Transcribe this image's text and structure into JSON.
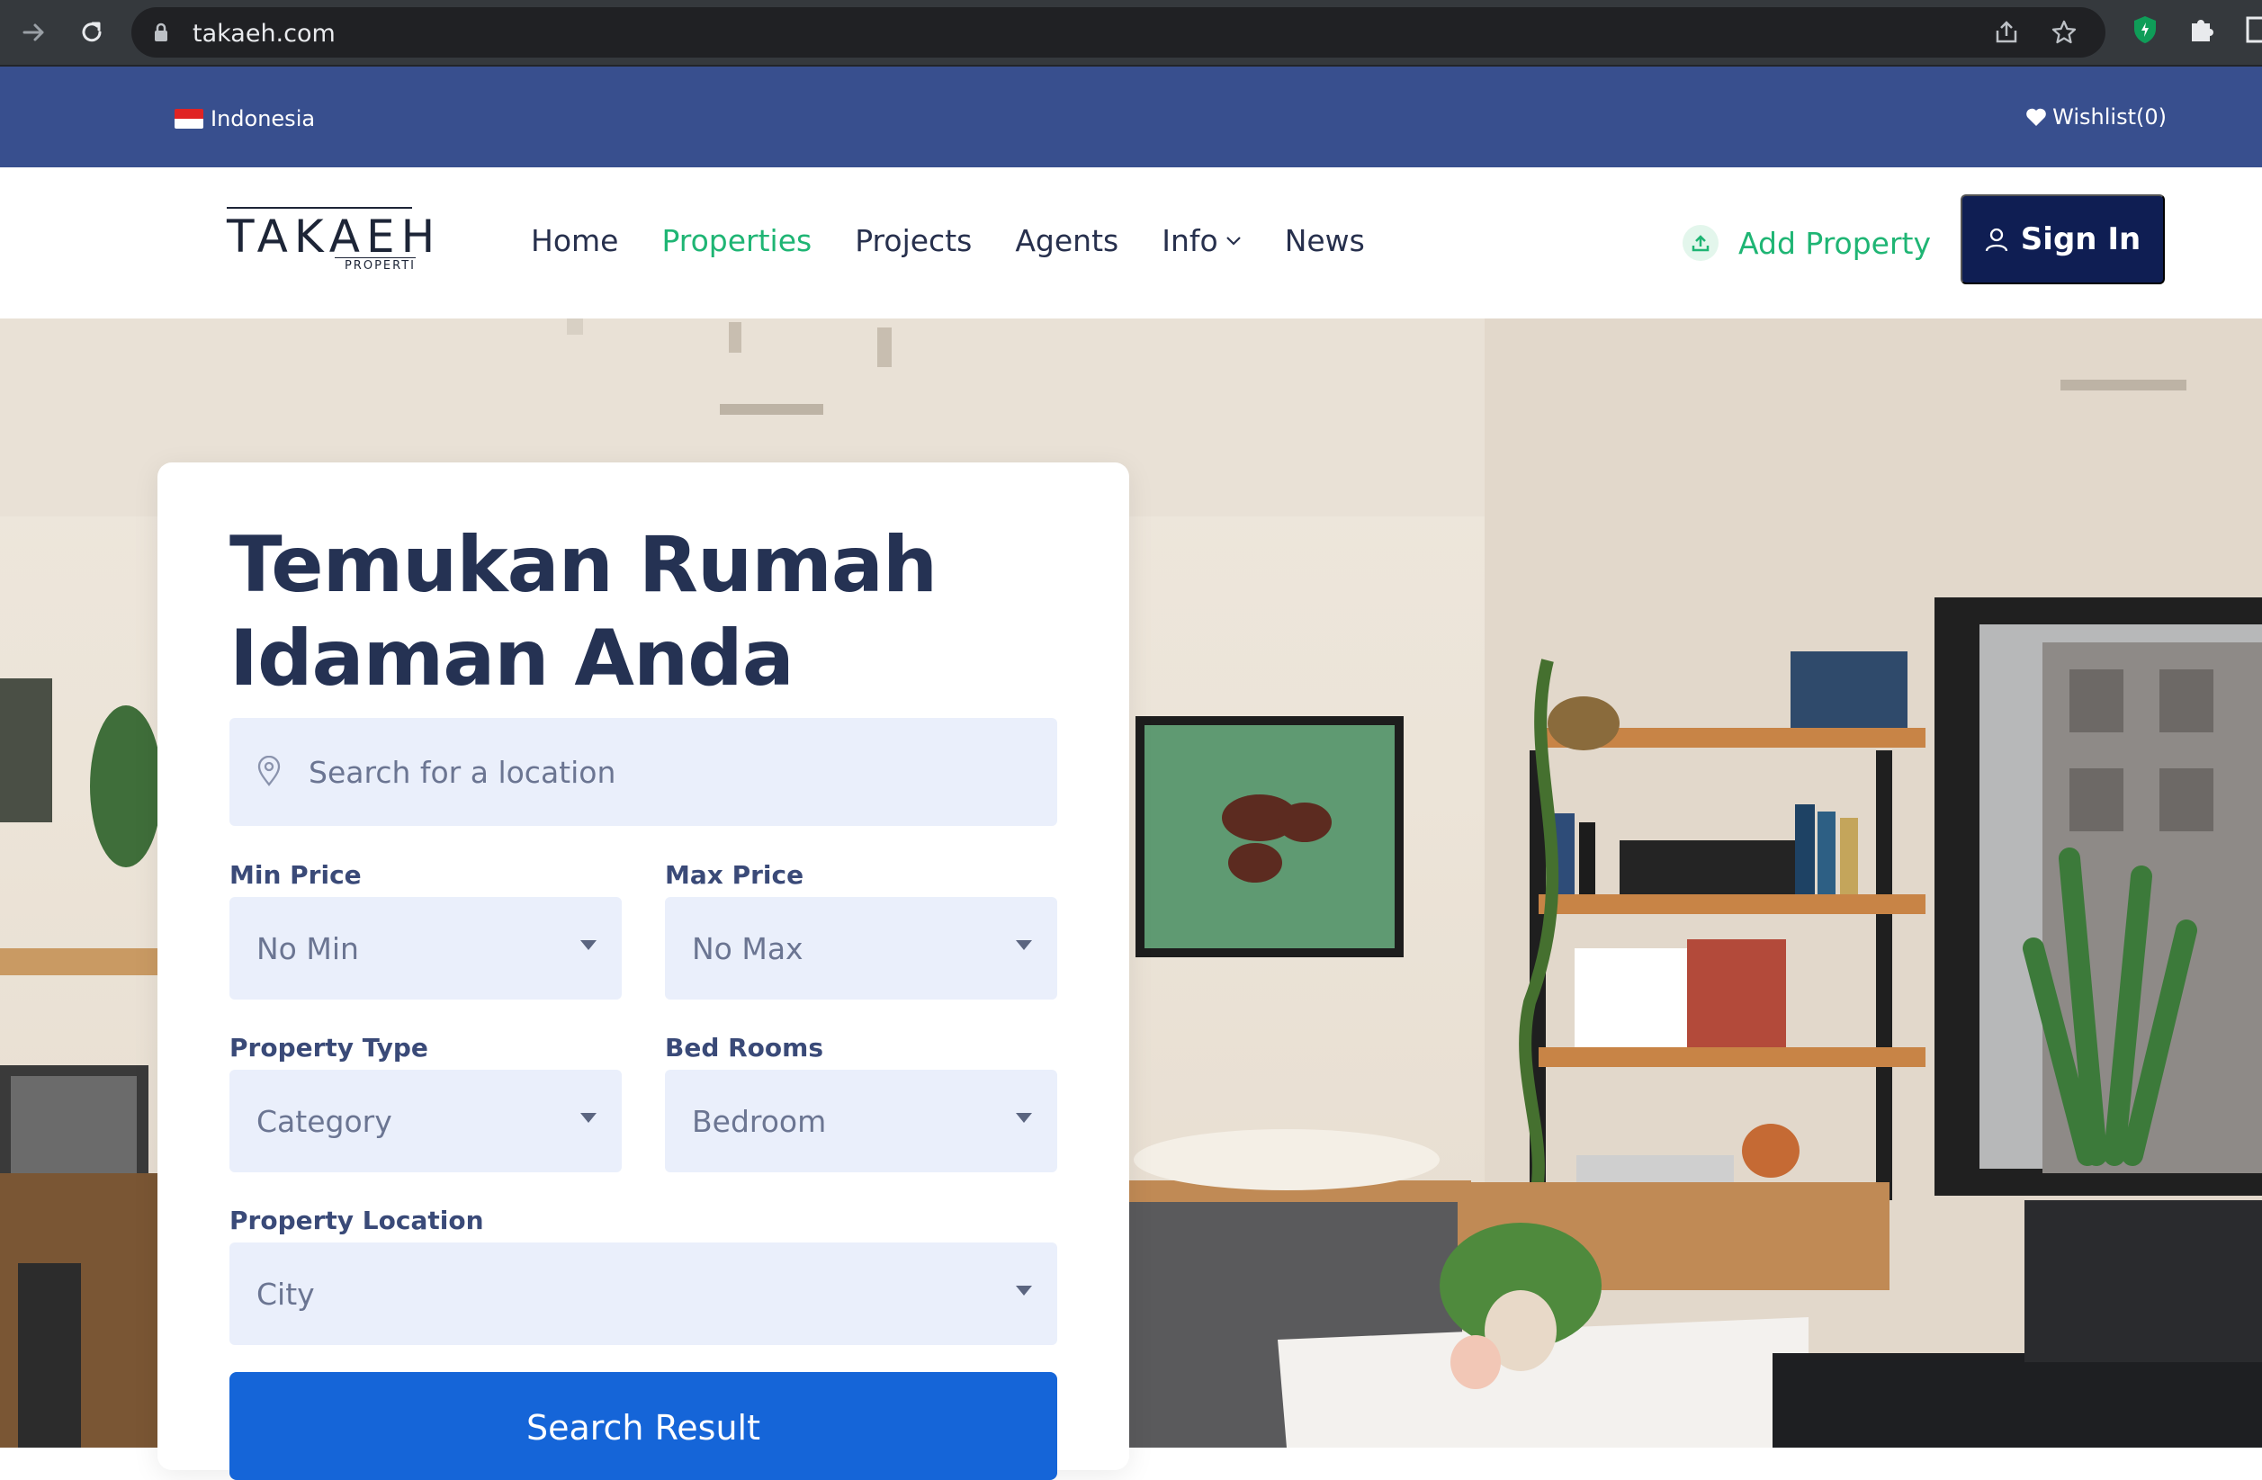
{
  "browser": {
    "url": "takaeh.com"
  },
  "topbar": {
    "country": "Indonesia",
    "wishlist": "Wishlist(0)"
  },
  "header": {
    "logo_main": "TAKAEH",
    "logo_sub": "PROPERTI",
    "menu": [
      {
        "label": "Home",
        "active": false
      },
      {
        "label": "Properties",
        "active": true
      },
      {
        "label": "Projects",
        "active": false
      },
      {
        "label": "Agents",
        "active": false
      },
      {
        "label": "Info",
        "active": false,
        "dropdown": true
      },
      {
        "label": "News",
        "active": false
      }
    ],
    "add_property": "Add Property",
    "sign_in": "Sign In"
  },
  "search": {
    "title": "Temukan Rumah Idaman Anda",
    "location_placeholder": "Search for a location",
    "min_price_label": "Min Price",
    "min_price_value": "No Min",
    "max_price_label": "Max Price",
    "max_price_value": "No Max",
    "property_type_label": "Property Type",
    "property_type_value": "Category",
    "bedrooms_label": "Bed Rooms",
    "bedrooms_value": "Bedroom",
    "location_label": "Property Location",
    "location_value": "City",
    "button": "Search Result"
  },
  "colors": {
    "topbar": "#384f8e",
    "accent_green": "#1fb574",
    "navy": "#0f1e53",
    "primary_blue": "#1565d8",
    "field_bg": "#eaeffb",
    "title": "#253253"
  },
  "icons": {
    "back": "arrow-right-icon",
    "reload": "reload-icon",
    "lock": "lock-icon",
    "share": "share-icon",
    "bookmark": "star-icon",
    "extension_shield": "shield-icon",
    "extensions": "puzzle-icon",
    "wishlist": "heart-icon",
    "add_property": "upload-icon",
    "sign_in": "user-icon",
    "location": "map-pin-icon",
    "dropdown": "caret-down-icon"
  }
}
